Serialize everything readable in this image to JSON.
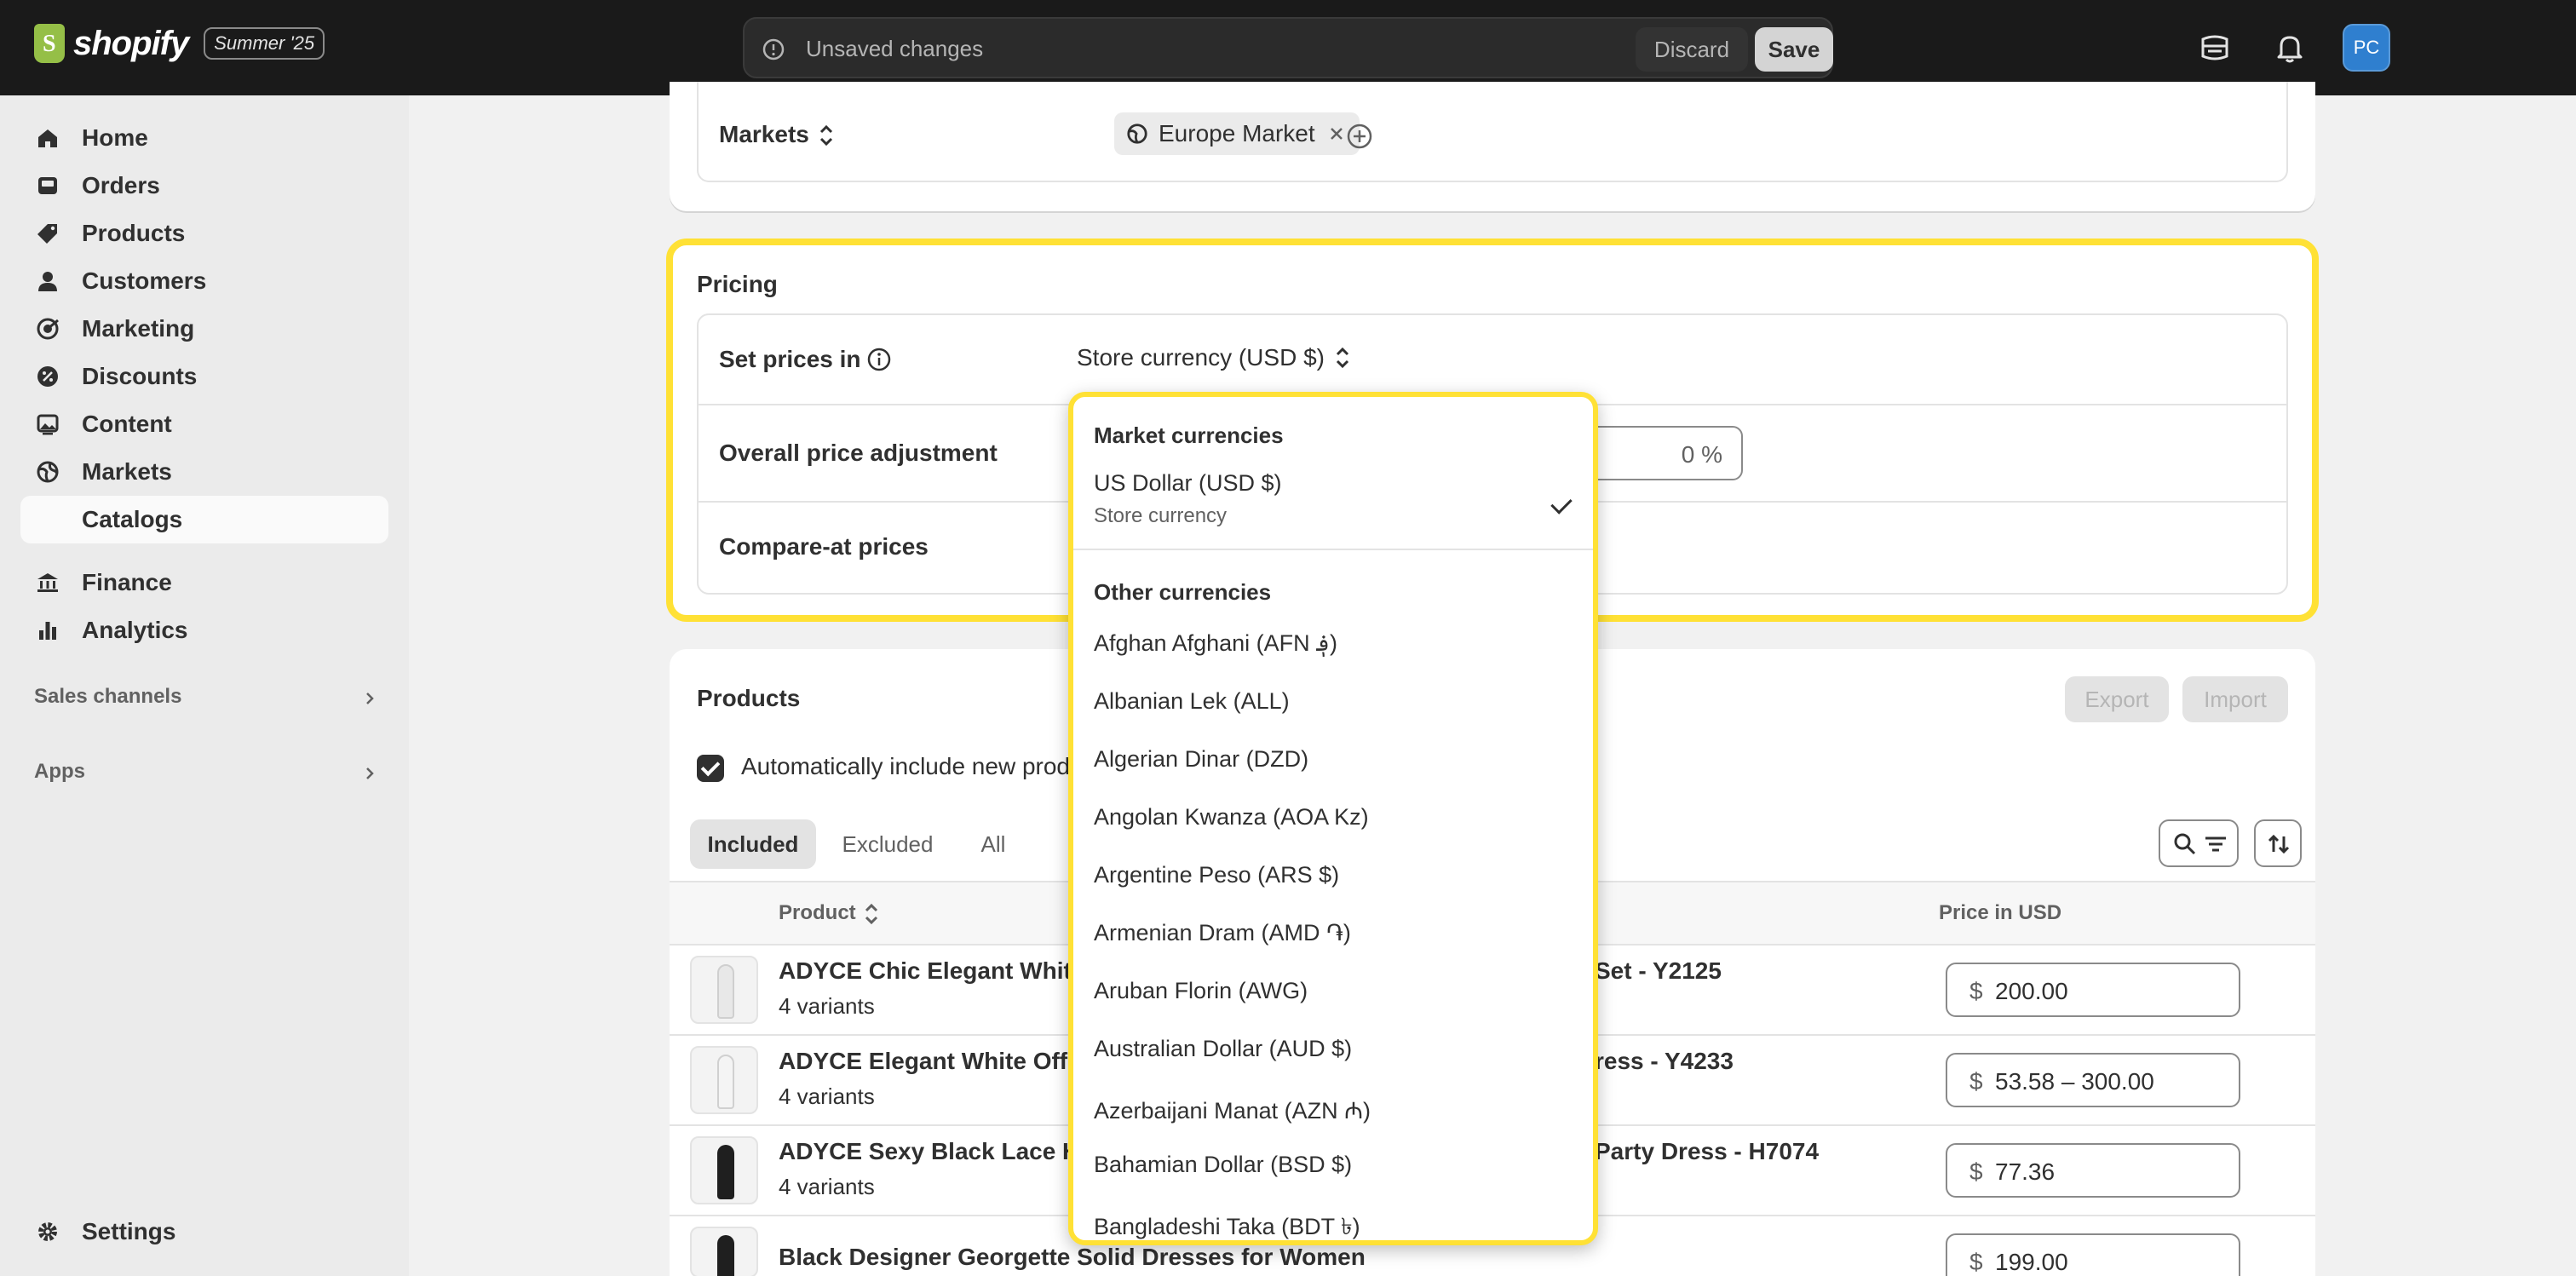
{
  "topbar": {
    "brand": "shopify",
    "edition_badge": "Summer '25",
    "unsaved_label": "Unsaved changes",
    "discard_label": "Discard",
    "save_label": "Save",
    "avatar_initials": "PC"
  },
  "sidebar": {
    "items": [
      {
        "label": "Home",
        "icon": "home-icon"
      },
      {
        "label": "Orders",
        "icon": "inbox-icon"
      },
      {
        "label": "Products",
        "icon": "tag-icon"
      },
      {
        "label": "Customers",
        "icon": "person-icon"
      },
      {
        "label": "Marketing",
        "icon": "target-icon"
      },
      {
        "label": "Discounts",
        "icon": "discount-icon"
      },
      {
        "label": "Content",
        "icon": "image-icon"
      },
      {
        "label": "Markets",
        "icon": "globe-icon"
      },
      {
        "label": "Catalogs",
        "icon": ""
      },
      {
        "label": "Finance",
        "icon": "bank-icon"
      },
      {
        "label": "Analytics",
        "icon": "bar-chart-icon"
      }
    ],
    "sales_channels_label": "Sales channels",
    "apps_label": "Apps",
    "settings_label": "Settings"
  },
  "markets_card": {
    "label": "Markets",
    "pill": "Europe Market"
  },
  "pricing_card": {
    "title": "Pricing",
    "set_prices_label": "Set prices in",
    "set_prices_value": "Store currency (USD $)",
    "adjustment_label": "Overall price adjustment",
    "adjustment_value": "0 %",
    "compare_label": "Compare-at prices"
  },
  "products_card": {
    "title": "Products",
    "export_label": "Export",
    "import_label": "Import",
    "auto_include_label": "Automatically include new prod",
    "tabs": [
      "Included",
      "Excluded",
      "All"
    ],
    "col_product": "Product",
    "col_price": "Price in USD",
    "rows": [
      {
        "name_left": "ADYCE Chic Elegant White",
        "name_right": "Set - Y2125",
        "variants": "4 variants",
        "currency": "$",
        "price": "200.00"
      },
      {
        "name_left": "ADYCE Elegant White Off S",
        "name_right": "ress - Y4233",
        "variants": "4 variants",
        "currency": "$",
        "price": "53.58 – 300.00"
      },
      {
        "name_left": "ADYCE Sexy Black Lace Ho",
        "name_right": "Party Dress - H7074",
        "variants": "4 variants",
        "currency": "$",
        "price": "77.36"
      },
      {
        "name_left": "Black Designer Georgette Solid Dresses for Women",
        "name_right": "",
        "variants": "",
        "currency": "$",
        "price": "199.00"
      }
    ]
  },
  "currency_dropdown": {
    "market_heading": "Market currencies",
    "selected_name": "US Dollar (USD $)",
    "selected_sub": "Store currency",
    "other_heading": "Other currencies",
    "options": [
      "Afghan Afghani (AFN ؋)",
      "Albanian Lek (ALL)",
      "Algerian Dinar (DZD)",
      "Angolan Kwanza (AOA Kz)",
      "Argentine Peso (ARS $)",
      "Armenian Dram (AMD ֏)",
      "Aruban Florin (AWG)",
      "Australian Dollar (AUD $)",
      "Azerbaijani Manat (AZN ₼)",
      "Bahamian Dollar (BSD $)",
      "Bangladeshi Taka (BDT ৳)"
    ]
  },
  "colors": {
    "topbar_bg": "#1a1a1a",
    "highlight": "#ffe135",
    "brand_green": "#95bf47",
    "avatar_blue": "#2f7fcf"
  }
}
